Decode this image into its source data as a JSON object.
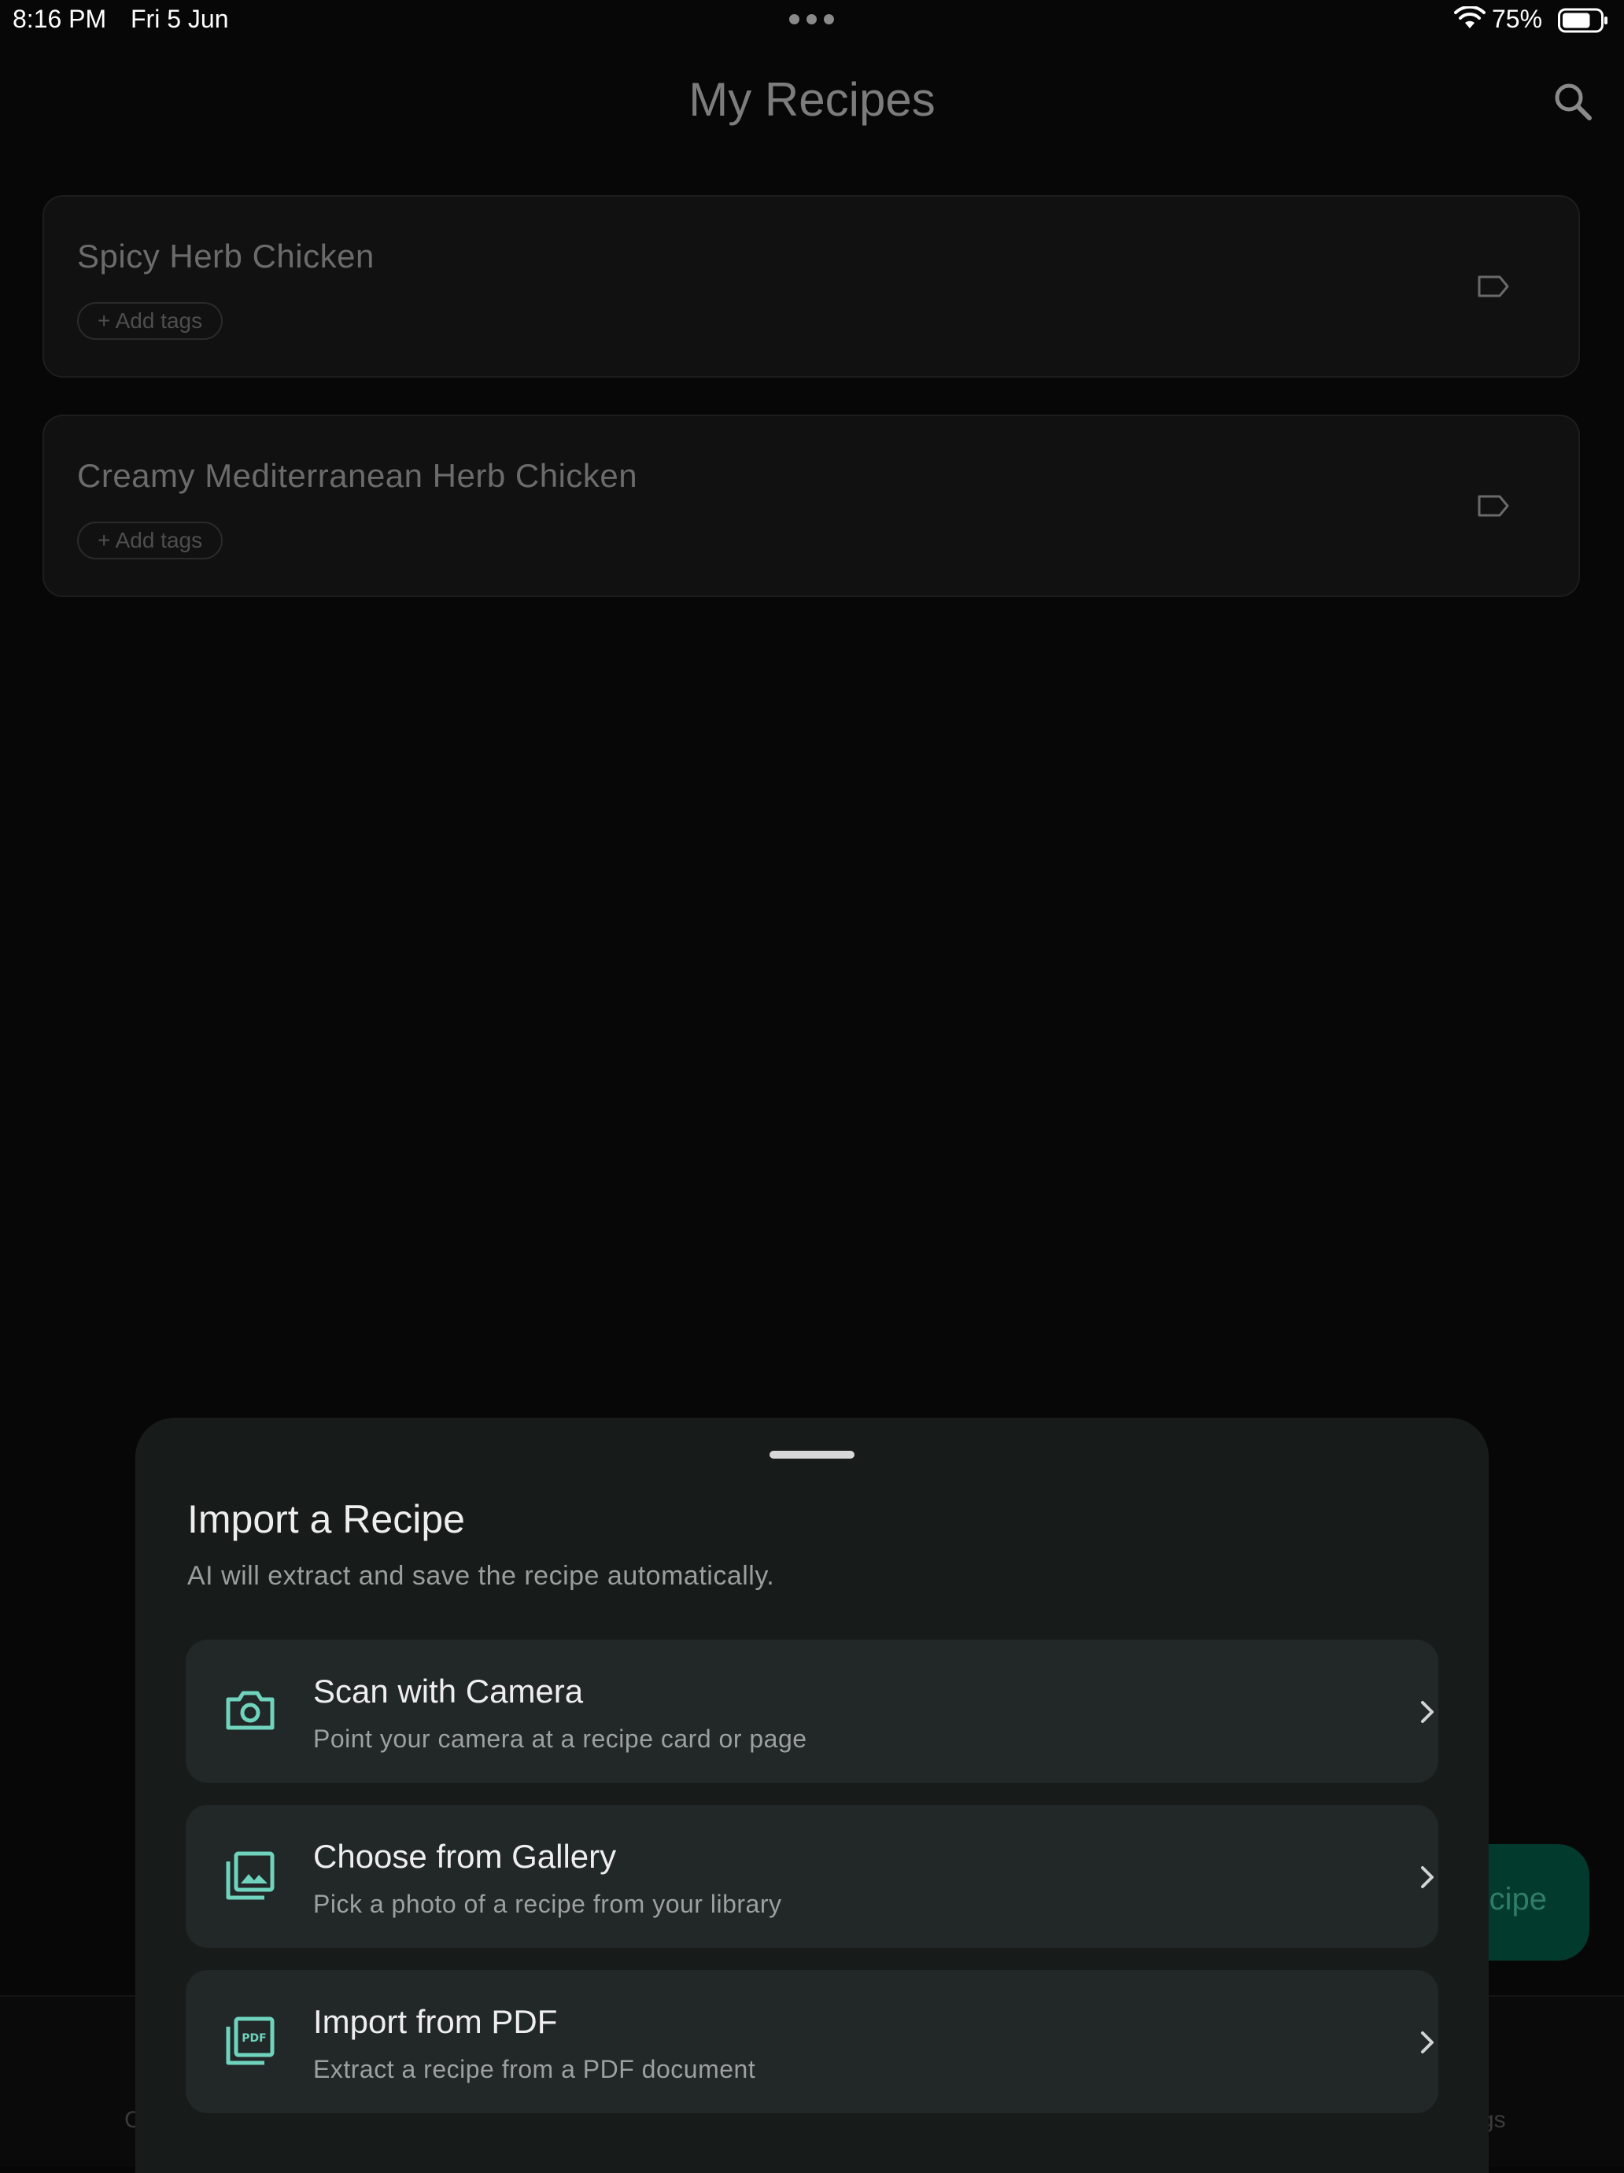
{
  "status_bar": {
    "time": "8:16 PM",
    "date": "Fri 5 Jun",
    "battery_percent": "75%",
    "battery_level": 0.75
  },
  "header": {
    "title": "My Recipes",
    "search_icon": "search-icon"
  },
  "recipes": [
    {
      "title": "Spicy Herb Chicken",
      "tag_button": "+ Add tags",
      "icon": "tag-icon"
    },
    {
      "title": "Creamy Mediterranean Herb Chicken",
      "tag_button": "+ Add tags",
      "icon": "tag-icon"
    }
  ],
  "fab": {
    "visible_label": "cipe"
  },
  "bottom_nav": {
    "left_fragment": "C",
    "right_fragment": "gs"
  },
  "import_sheet": {
    "title": "Import a Recipe",
    "subtitle": "AI will extract and save the recipe automatically.",
    "options": [
      {
        "icon": "camera-icon",
        "title": "Scan with Camera",
        "subtitle": "Point your camera at a recipe card or page"
      },
      {
        "icon": "gallery-icon",
        "title": "Choose from Gallery",
        "subtitle": "Pick a photo of a recipe from your library"
      },
      {
        "icon": "pdf-icon",
        "title": "Import from PDF",
        "subtitle": "Extract a recipe from a PDF document"
      }
    ]
  },
  "colors": {
    "background": "#070707",
    "card": "#111111",
    "sheet": "#171c1b",
    "option": "#212827",
    "accent": "#6fd3bd",
    "fab": "#033a2e"
  }
}
